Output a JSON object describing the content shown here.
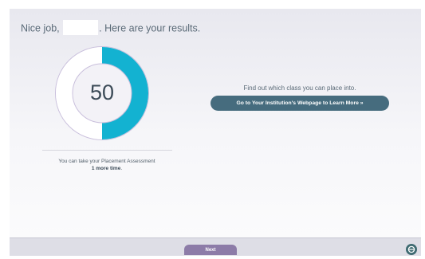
{
  "results": {
    "headline_prefix": "Nice job,",
    "headline_suffix": ". Here are your results.",
    "score": "50",
    "score_fraction": 0.5,
    "colors": {
      "ring_fill": "#13b2d1",
      "ring_track": "#ffffff",
      "ring_border": "#c9bfdc",
      "button": "#466c7e",
      "next_button": "#8d7ca8",
      "help_button": "#3f6b72"
    }
  },
  "attempts": {
    "line1": "You can take your Placement Assessment",
    "count_text": "1 more time",
    "suffix": "."
  },
  "placement": {
    "prompt": "Find out which class you can place into.",
    "cta_label": "Go to Your Institution's Webpage to Learn More »"
  },
  "footer": {
    "next_label": "Next",
    "help_icon": "help-icon"
  }
}
